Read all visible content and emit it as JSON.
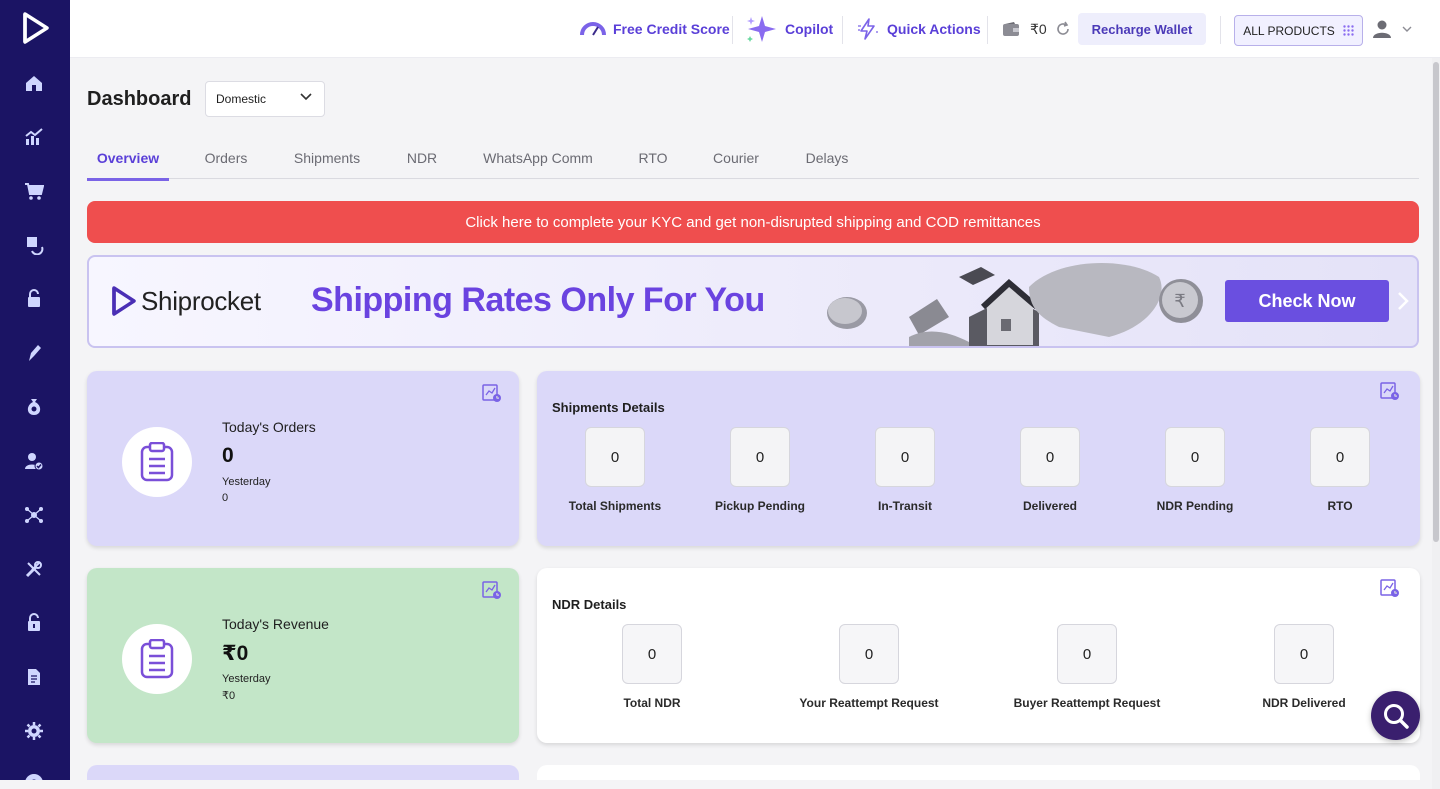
{
  "topbar": {
    "credit_score": "Free Credit Score",
    "copilot": "Copilot",
    "quick_actions": "Quick Actions",
    "wallet_balance": "₹0",
    "recharge": "Recharge Wallet",
    "all_products": "ALL PRODUCTS"
  },
  "page": {
    "title": "Dashboard",
    "region_select": "Domestic"
  },
  "tabs": [
    {
      "label": "Overview",
      "active": true
    },
    {
      "label": "Orders"
    },
    {
      "label": "Shipments"
    },
    {
      "label": "NDR"
    },
    {
      "label": "WhatsApp Comm"
    },
    {
      "label": "RTO"
    },
    {
      "label": "Courier"
    },
    {
      "label": "Delays"
    }
  ],
  "kyc_banner": "Click here to complete your KYC and get non-disrupted shipping and COD remittances",
  "promo": {
    "brand": "Shiprocket",
    "headline": "Shipping Rates Only For You",
    "cta": "Check Now"
  },
  "orders_card": {
    "label": "Today's Orders",
    "value": "0",
    "sub_label": "Yesterday",
    "sub_value": "0"
  },
  "revenue_card": {
    "label": "Today's Revenue",
    "value": "₹0",
    "sub_label": "Yesterday",
    "sub_value": "₹0"
  },
  "shipments": {
    "title": "Shipments Details",
    "metrics": [
      {
        "label": "Total Shipments",
        "value": "0"
      },
      {
        "label": "Pickup Pending",
        "value": "0"
      },
      {
        "label": "In-Transit",
        "value": "0"
      },
      {
        "label": "Delivered",
        "value": "0"
      },
      {
        "label": "NDR Pending",
        "value": "0"
      },
      {
        "label": "RTO",
        "value": "0"
      }
    ]
  },
  "ndr": {
    "title": "NDR Details",
    "metrics": [
      {
        "label": "Total NDR",
        "value": "0"
      },
      {
        "label": "Your Reattempt Request",
        "value": "0"
      },
      {
        "label": "Buyer Reattempt Request",
        "value": "0"
      },
      {
        "label": "NDR Delivered",
        "value": "0"
      }
    ]
  },
  "colors": {
    "sidebar": "#1b1464",
    "accent": "#5a3fd8",
    "kyc_red": "#ef4e4e",
    "lavender_card": "#dbd8f9",
    "mint_card": "#c3e6c8"
  },
  "icons": {
    "sidebar": [
      "home-icon",
      "analytics-icon",
      "cart-icon",
      "returns-icon",
      "lock-icon",
      "pen-icon",
      "money-bag-icon",
      "user-check-icon",
      "network-icon",
      "tools-icon",
      "unlock-icon",
      "document-icon",
      "gear-icon",
      "help-icon"
    ]
  }
}
